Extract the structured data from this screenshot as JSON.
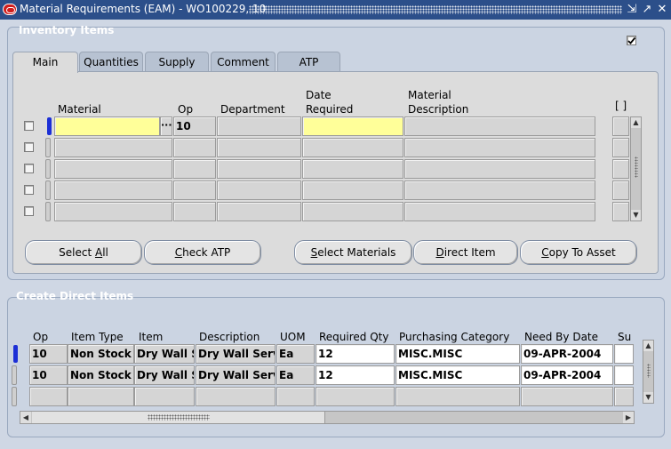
{
  "window": {
    "title": "Material Requirements (EAM) - WO100229, 10",
    "minimize_glyph": "⇲",
    "maximize_glyph": "↗",
    "close_glyph": "✕"
  },
  "inventory": {
    "title": "Inventory Items",
    "checkbox_checked": true,
    "tabs": [
      {
        "label": "Main",
        "active": true
      },
      {
        "label": "Quantities",
        "active": false
      },
      {
        "label": "Supply",
        "active": false
      },
      {
        "label": "Comment",
        "active": false
      },
      {
        "label": "ATP",
        "active": false
      }
    ],
    "columns": {
      "material": "Material",
      "op": "Op",
      "department": "Department",
      "date_required_1": "Date",
      "date_required_2": "Required",
      "description_1": "Material",
      "description_2": "Description",
      "flex": "[ ]"
    },
    "row1": {
      "material": "",
      "lov": "···",
      "op": "10",
      "department": "",
      "date_required": "",
      "description": ""
    },
    "buttons": {
      "select_all": "Select All",
      "check_atp": "Check ATP",
      "select_materials": "Select Materials",
      "direct_item": "Direct Item",
      "copy_to_asset": "Copy To Asset"
    }
  },
  "direct": {
    "title": "Create Direct Items",
    "columns": {
      "op": "Op",
      "item_type": "Item Type",
      "item": "Item",
      "description": "Description",
      "uom": "UOM",
      "required_qty": "Required Qty",
      "purchasing_category": "Purchasing Category",
      "need_by_date": "Need By Date",
      "supplier": "Su"
    },
    "rows": [
      {
        "op": "10",
        "item_type": "Non Stock I",
        "item": "Dry Wall S",
        "description": "Dry Wall Serv",
        "uom": "Ea",
        "required_qty": "12",
        "purchasing_category": "MISC.MISC",
        "need_by_date": "09-APR-2004"
      },
      {
        "op": "10",
        "item_type": "Non Stock I",
        "item": "Dry Wall S",
        "description": "Dry Wall Serv",
        "uom": "Ea",
        "required_qty": "12",
        "purchasing_category": "MISC.MISC",
        "need_by_date": "09-APR-2004"
      }
    ]
  },
  "colors": {
    "titlebar": "#2c4f8a",
    "required_field": "#ffff99",
    "focus": "#1c2fd6",
    "panel": "#cbd4e2"
  }
}
